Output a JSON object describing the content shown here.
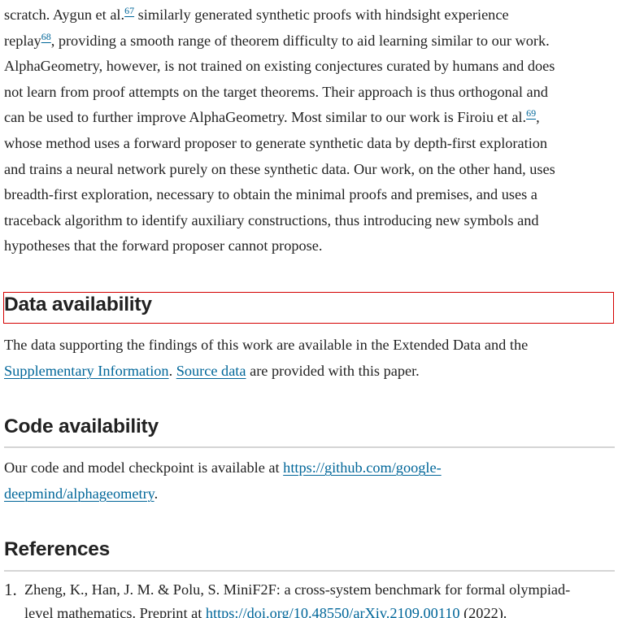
{
  "intro_paragraph": {
    "line1": {
      "before_ref": "scratch. Aygun et al.",
      "ref": "67",
      "after_ref": " similarly generated synthetic proofs with hindsight experience"
    },
    "line2": {
      "before_ref": "replay",
      "ref": "68",
      "after_ref": ", providing a smooth range of theorem difficulty to aid learning similar to our work."
    },
    "line3": "AlphaGeometry, however, is not trained on existing conjectures curated by humans and does",
    "line4": "not learn from proof attempts on the target theorems. Their approach is thus orthogonal and",
    "line5": {
      "before_ref": "can be used to further improve AlphaGeometry. Most similar to our work is Firoiu et al.",
      "ref": "69",
      "after_ref": ","
    },
    "line6": "whose method uses a forward proposer to generate synthetic data by depth-first exploration",
    "line7": "and trains a neural network purely on these synthetic data. Our work, on the other hand, uses",
    "line8": "breadth-first exploration, necessary to obtain the minimal proofs and premises, and uses a",
    "line9": "traceback algorithm to identify auxiliary constructions, thus introducing new symbols and",
    "line10": "hypotheses that the forward proposer cannot propose."
  },
  "data_availability": {
    "heading": "Data availability",
    "line1": "The data supporting the findings of this work are available in the Extended Data and the",
    "link_supplementary": "Supplementary Information",
    "separator": ". ",
    "link_source_data": "Source data",
    "tail": " are provided with this paper."
  },
  "code_availability": {
    "heading": "Code availability",
    "text_before_link": "Our code and model checkpoint is available at ",
    "link_part1": "https://github.com/google-",
    "link_part2": "deepmind/alphageometry",
    "tail": "."
  },
  "references": {
    "heading": "References",
    "items": [
      {
        "number": "1.",
        "line1": "Zheng, K., Han, J. M. & Polu, S. MiniF2F: a cross-system benchmark for formal olympiad-",
        "line2_before_link": "level mathematics. Preprint at ",
        "line2_link": "https://doi.org/10.48550/arXiv.2109.00110",
        "line2_after_link": " (2022)."
      }
    ]
  }
}
